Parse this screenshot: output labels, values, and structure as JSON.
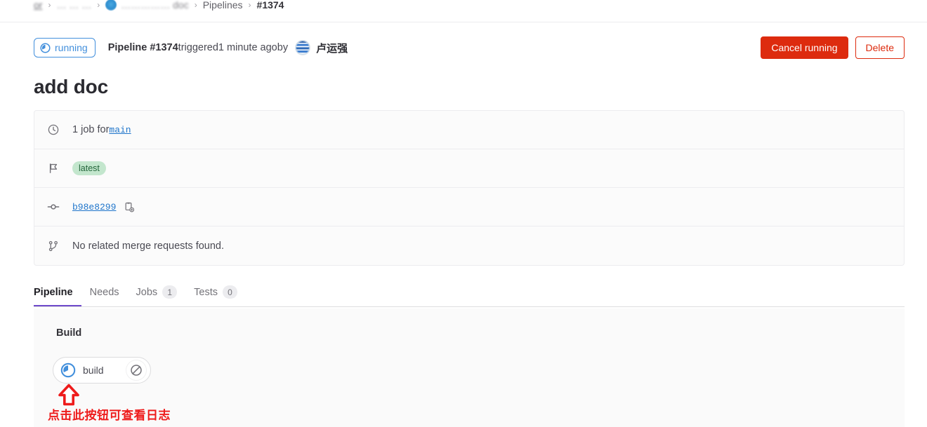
{
  "breadcrumb": {
    "items": [
      {
        "label": "or",
        "type": "link-blurred-first"
      },
      {
        "label": "… … …",
        "type": "link-blurred"
      },
      {
        "label": "…………… doc",
        "type": "link-blurred-avatar"
      },
      {
        "label": "Pipelines",
        "type": "link"
      }
    ],
    "separator": "›",
    "current": "#1374"
  },
  "header": {
    "status_label": "running",
    "status_icon": "status-running-icon",
    "status_color": "#428fdc",
    "meta_prefix": "Pipeline",
    "pipeline_number": "#1374",
    "meta_middle": " triggered ",
    "time_ago": "1 minute ago",
    "meta_suffix": " by ",
    "user_name": "卢运强",
    "cancel_label": "Cancel running",
    "delete_label": "Delete",
    "danger_color": "#dd2b0e"
  },
  "title": "add doc",
  "info_card": {
    "rows": [
      {
        "icon": "clock-icon",
        "text_prefix": "1 job for ",
        "ref": "main",
        "ref_color": "#1f75cb"
      },
      {
        "icon": "flag-icon",
        "badge": "latest",
        "badge_bg": "#c3e6cd",
        "badge_color": "#24663b"
      },
      {
        "icon": "commit-icon",
        "commit_sha": "b98e8299",
        "copy_icon": "copy-icon"
      },
      {
        "icon": "merge-request-icon",
        "text": "No related merge requests found."
      }
    ]
  },
  "tabs": [
    {
      "label": "Pipeline",
      "badge": null,
      "active": true
    },
    {
      "label": "Needs",
      "badge": null,
      "active": false
    },
    {
      "label": "Jobs",
      "badge": "1",
      "active": false
    },
    {
      "label": "Tests",
      "badge": "0",
      "active": false
    }
  ],
  "graph": {
    "stage_name": "Build",
    "job": {
      "status_icon": "status-running-icon",
      "label": "build",
      "action_icon": "cancel-icon"
    }
  },
  "annotation": {
    "arrow_icon": "up-arrow-annotation-icon",
    "text": "点击此按钮可查看日志",
    "color": "#ee1b1b"
  }
}
